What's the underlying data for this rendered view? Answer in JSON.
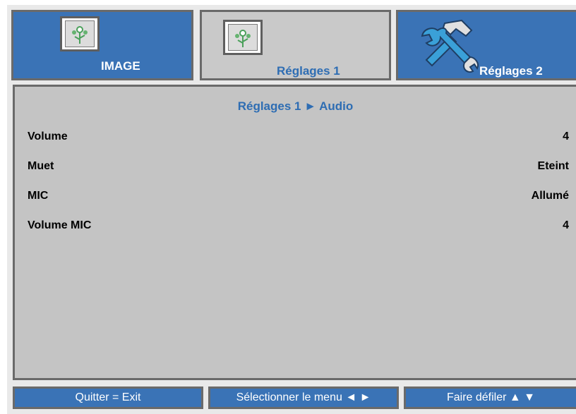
{
  "tabs": [
    {
      "label": "IMAGE",
      "icon": "picture-icon"
    },
    {
      "label": "Réglages 1",
      "icon": "picture-icon"
    },
    {
      "label": "Réglages 2",
      "icon": "tools-icon"
    }
  ],
  "panel": {
    "title": "Réglages 1 ► Audio",
    "rows": [
      {
        "label": "Volume",
        "value": "4"
      },
      {
        "label": "Muet",
        "value": "Eteint"
      },
      {
        "label": "MIC",
        "value": "Allumé"
      },
      {
        "label": "Volume MIC",
        "value": "4"
      }
    ]
  },
  "footer": {
    "exit": "Quitter = Exit",
    "select": "Sélectionner le menu ◄ ►",
    "scroll": "Faire défiler ▲ ▼"
  },
  "colors": {
    "accent_blue": "#3a73b6",
    "panel_gray": "#c4c4c4",
    "title_blue": "#2e6db3"
  }
}
